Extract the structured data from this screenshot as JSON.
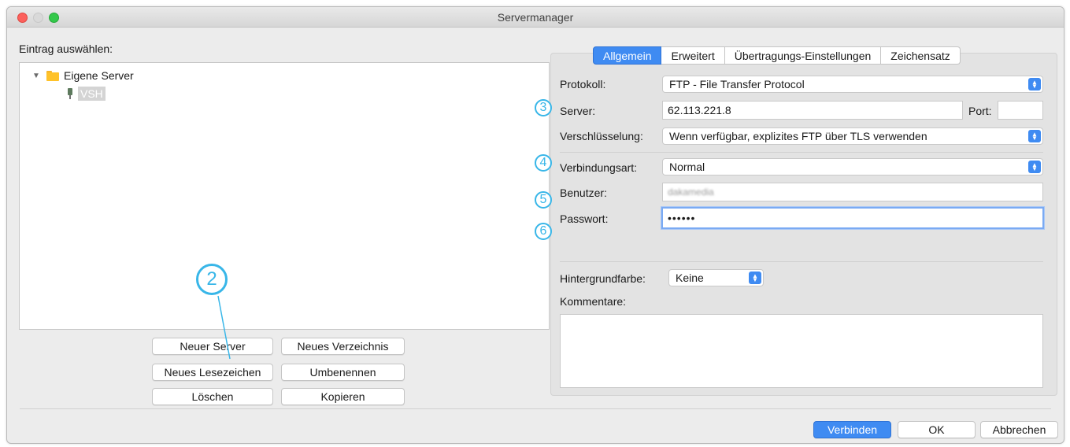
{
  "window": {
    "title": "Servermanager"
  },
  "left": {
    "heading": "Eintrag auswählen:",
    "tree": {
      "folder": "Eigene Server",
      "server": "VSH"
    },
    "buttons": {
      "new_server": "Neuer Server",
      "new_folder": "Neues Verzeichnis",
      "new_bookmark": "Neues Lesezeichen",
      "rename": "Umbenennen",
      "delete": "Löschen",
      "copy": "Kopieren"
    }
  },
  "tabs": [
    "Allgemein",
    "Erweitert",
    "Übertragungs-Einstellungen",
    "Zeichensatz"
  ],
  "form": {
    "protocol_label": "Protokoll:",
    "protocol_value": "FTP - File Transfer Protocol",
    "server_label": "Server:",
    "server_value": "62.113.221.8",
    "port_label": "Port:",
    "port_value": "",
    "encryption_label": "Verschlüsselung:",
    "encryption_value": "Wenn verfügbar, explizites FTP über TLS verwenden",
    "logon_label": "Verbindungsart:",
    "logon_value": "Normal",
    "user_label": "Benutzer:",
    "user_value": "dakamedia",
    "password_label": "Passwort:",
    "password_value": "••••••",
    "bgcolor_label": "Hintergrundfarbe:",
    "bgcolor_value": "Keine",
    "comments_label": "Kommentare:",
    "comments_value": ""
  },
  "callouts": {
    "c2": "2",
    "c3": "3",
    "c4": "4",
    "c5": "5",
    "c6": "6"
  },
  "footer": {
    "connect": "Verbinden",
    "ok": "OK",
    "cancel": "Abbrechen"
  },
  "colors": {
    "accent": "#3f8bf2",
    "callout": "#38b6e8"
  }
}
